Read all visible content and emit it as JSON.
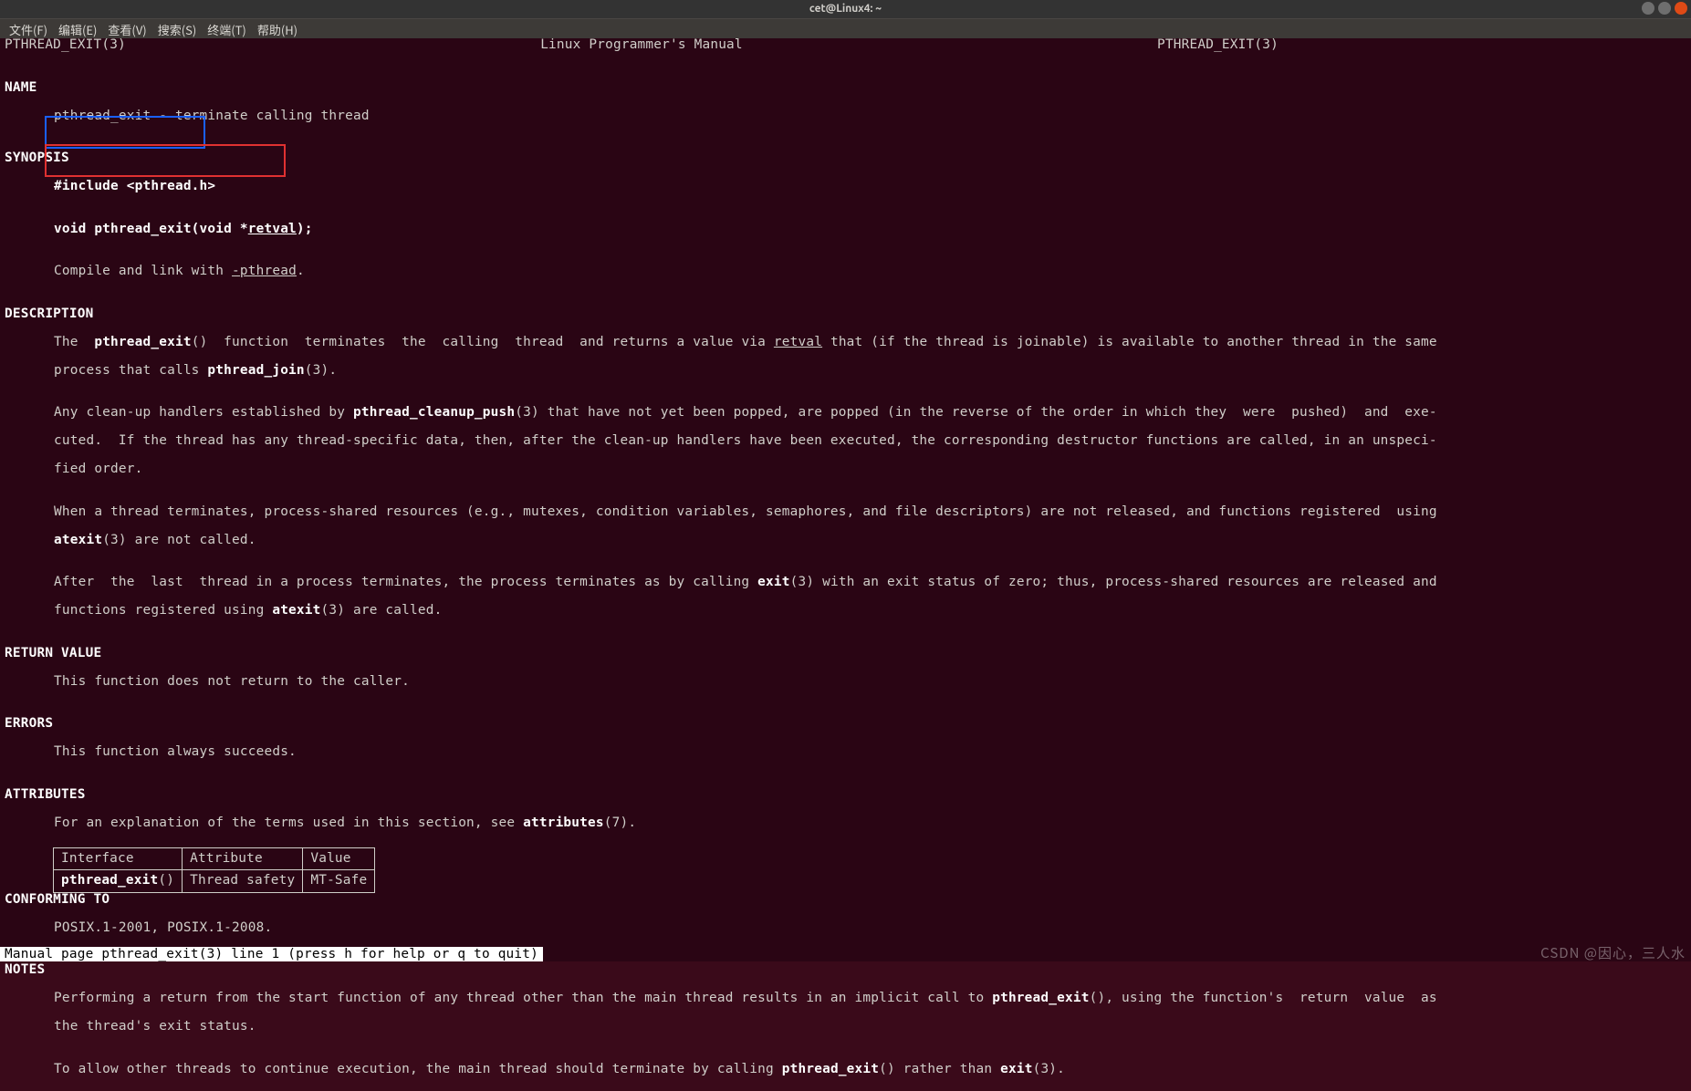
{
  "titlebar": {
    "title": "cet@Linux4: ~"
  },
  "menubar": {
    "items": [
      {
        "label": "文件(F)"
      },
      {
        "label": "编辑(E)"
      },
      {
        "label": "查看(V)"
      },
      {
        "label": "搜索(S)"
      },
      {
        "label": "终端(T)"
      },
      {
        "label": "帮助(H)"
      }
    ]
  },
  "header": {
    "left": "PTHREAD_EXIT(3)",
    "center": "Linux Programmer's Manual",
    "right": "PTHREAD_EXIT(3)"
  },
  "sections": {
    "name": {
      "title": "NAME",
      "text": "pthread_exit - terminate calling thread"
    },
    "synopsis": {
      "title": "SYNOPSIS",
      "include": "#include <pthread.h>",
      "proto_pre": "void pthread_exit(void *",
      "proto_arg": "retval",
      "proto_post": ");",
      "compile_pre": "Compile and link with ",
      "compile_flag": "-pthread",
      "compile_post": "."
    },
    "description": {
      "title": "DESCRIPTION",
      "p1a": "The  ",
      "p1b": "pthread_exit",
      "p1c": "()  function  terminates  the  calling  thread  and returns a value via ",
      "p1d": "retval",
      "p1e": " that (if the thread is joinable) is available to another thread in the same",
      "p1f": "process that calls ",
      "p1g": "pthread_join",
      "p1h": "(3).",
      "p2a": "Any clean-up handlers established by ",
      "p2b": "pthread_cleanup_push",
      "p2c": "(3) that have not yet been popped, are popped (in the reverse of the order in which they  were  pushed)  and  exe‐",
      "p2d": "cuted.  If the thread has any thread-specific data, then, after the clean-up handlers have been executed, the corresponding destructor functions are called, in an unspeci‐",
      "p2e": "fied order.",
      "p3a": "When a thread terminates, process-shared resources (e.g., mutexes, condition variables, semaphores, and file descriptors) are not released, and functions registered  using",
      "p3b": "atexit",
      "p3c": "(3) are not called.",
      "p4a": "After  the  last  thread in a process terminates, the process terminates as by calling ",
      "p4b": "exit",
      "p4c": "(3) with an exit status of zero; thus, process-shared resources are released and",
      "p4d": "functions registered using ",
      "p4e": "atexit",
      "p4f": "(3) are called."
    },
    "return_value": {
      "title": "RETURN VALUE",
      "text": "This function does not return to the caller."
    },
    "errors": {
      "title": "ERRORS",
      "text": "This function always succeeds."
    },
    "attributes": {
      "title": "ATTRIBUTES",
      "intro_pre": "For an explanation of the terms used in this section, see ",
      "intro_bold": "attributes",
      "intro_post": "(7).",
      "table": {
        "h1": "Interface",
        "h2": "Attribute",
        "h3": "Value",
        "c1a": "pthread_exit",
        "c1b": "()",
        "c2": "Thread safety",
        "c3": "MT-Safe"
      }
    },
    "conforming": {
      "title": "CONFORMING TO",
      "text": "POSIX.1-2001, POSIX.1-2008."
    },
    "notes": {
      "title": "NOTES",
      "p1a": "Performing a return from the start function of any thread other than the main thread results in an implicit call to ",
      "p1b": "pthread_exit",
      "p1c": "(), using the function's  return  value  as",
      "p1d": "the thread's exit status.",
      "p2a": "To allow other threads to continue execution, the main thread should terminate by calling ",
      "p2b": "pthread_exit",
      "p2c": "() rather than ",
      "p2d": "exit",
      "p2e": "(3)."
    }
  },
  "status_bar": "Manual page pthread_exit(3) line 1 (press h for help or q to quit)",
  "watermark": "CSDN @因心，三人水"
}
